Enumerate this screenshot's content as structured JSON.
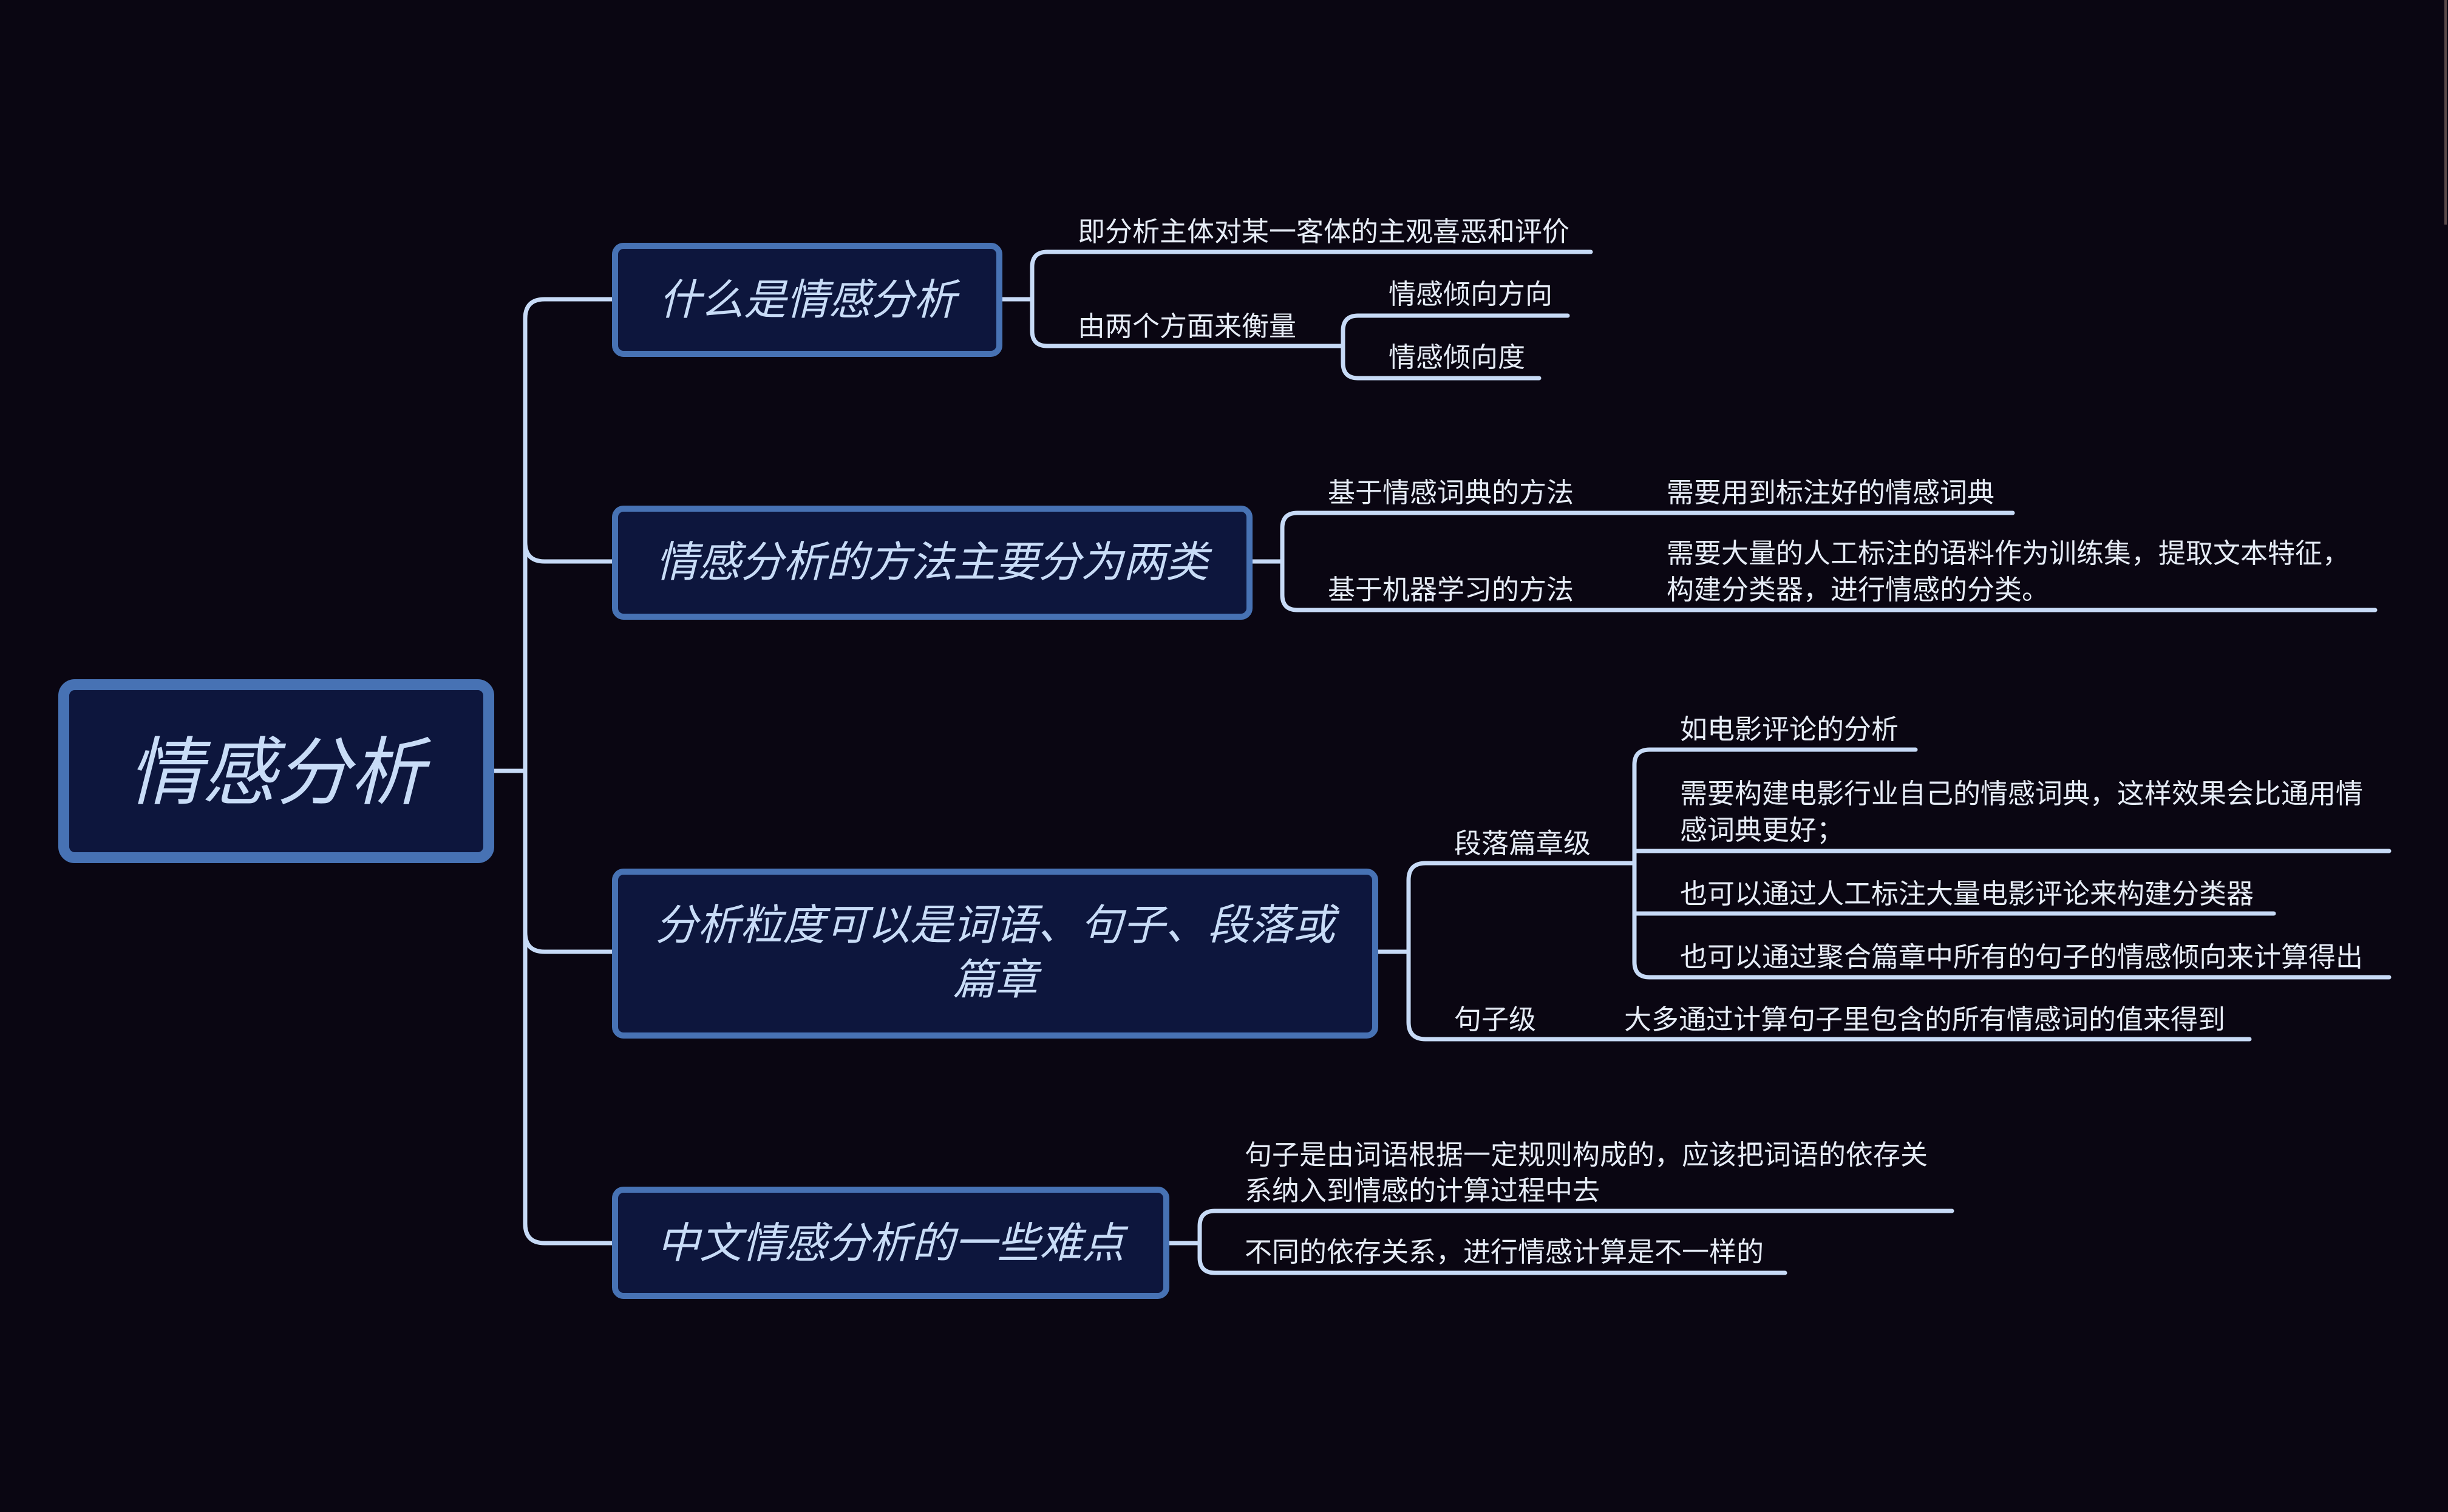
{
  "root": "情感分析",
  "topics": [
    {
      "label": [
        "什么是情感分析"
      ]
    },
    {
      "label": [
        "情感分析的方法主要分为两类"
      ]
    },
    {
      "label": [
        "分析粒度可以是词语、句子、段落或",
        "篇章"
      ]
    },
    {
      "label": [
        "中文情感分析的一些难点"
      ]
    }
  ],
  "subtopics": [
    {
      "label": [
        "即分析主体对某一客体的主观喜恶和评价"
      ]
    },
    {
      "label": [
        "由两个方面来衡量"
      ]
    },
    {
      "label": [
        "情感倾向方向"
      ]
    },
    {
      "label": [
        "情感倾向度"
      ]
    },
    {
      "label": [
        "基于情感词典的方法"
      ]
    },
    {
      "label": [
        "需要用到标注好的情感词典"
      ]
    },
    {
      "label": [
        "基于机器学习的方法"
      ]
    },
    {
      "label": [
        "需要大量的人工标注的语料作为训练集，提取文本特征，",
        "构建分类器，进行情感的分类。"
      ]
    },
    {
      "label": [
        "段落篇章级"
      ]
    },
    {
      "label": [
        "如电影评论的分析"
      ]
    },
    {
      "label": [
        "需要构建电影行业自己的情感词典，这样效果会比通用情",
        "感词典更好；"
      ]
    },
    {
      "label": [
        "也可以通过人工标注大量电影评论来构建分类器"
      ]
    },
    {
      "label": [
        "也可以通过聚合篇章中所有的句子的情感倾向来计算得出"
      ]
    },
    {
      "label": [
        "句子级"
      ]
    },
    {
      "label": [
        "大多通过计算句子里包含的所有情感词的值来得到"
      ]
    },
    {
      "label": [
        "句子是由词语根据一定规则构成的，应该把词语的依存关",
        "系纳入到情感的计算过程中去"
      ]
    },
    {
      "label": [
        "不同的依存关系，进行情感计算是不一样的"
      ]
    }
  ],
  "colors": {
    "background": "#0a0612",
    "node_fill": "#0d163d",
    "node_border": "#4772b4",
    "node_text": "#c8dcf7",
    "connector": "#c7daf6",
    "leaf_text": "#e6ecf6"
  }
}
